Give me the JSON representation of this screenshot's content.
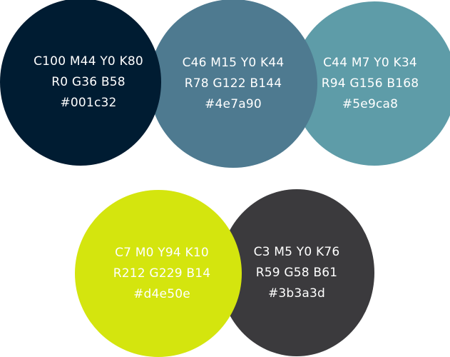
{
  "swatches": [
    {
      "id": "navy",
      "cmyk": "C100 M44 Y0 K80",
      "rgb": "R0 G36 B58",
      "hex": "#001c32",
      "fill": "#001c32",
      "text_color": "#ffffff"
    },
    {
      "id": "steel-blue",
      "cmyk": "C46 M15 Y0 K44",
      "rgb": "R78 G122 B144",
      "hex": "#4e7a90",
      "fill": "#4e7a90",
      "text_color": "#ffffff"
    },
    {
      "id": "teal",
      "cmyk": "C44 M7 Y0 K34",
      "rgb": "R94 G156 B168",
      "hex": "#5e9ca8",
      "fill": "#5e9ca8",
      "text_color": "#ffffff"
    },
    {
      "id": "lime",
      "cmyk": "C7 M0 Y94 K10",
      "rgb": "R212 G229 B14",
      "hex": "#d4e50e",
      "fill": "#d4e50e",
      "text_color": "#ffffff"
    },
    {
      "id": "charcoal",
      "cmyk": "C3 M5 Y0 K76",
      "rgb": "R59 G58 B61",
      "hex": "#3b3a3d",
      "fill": "#3b3a3d",
      "text_color": "#ffffff"
    }
  ]
}
